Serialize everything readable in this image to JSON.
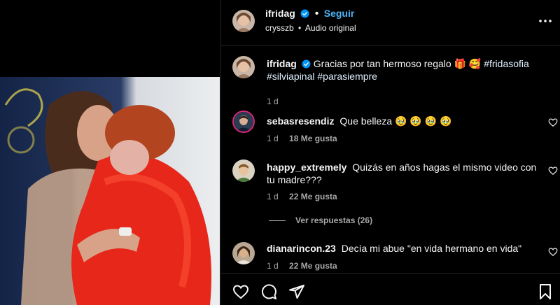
{
  "post": {
    "author": "ifridag",
    "follow_label": "Seguir",
    "audio_user": "crysszb",
    "audio_sep": "•",
    "audio_label": "Audio original"
  },
  "caption": {
    "author": "ifridag",
    "text": "Gracias por tan hermoso regalo 🎁 🥰",
    "hashtags": "#fridasofia #silviapinal #parasiempre",
    "time": "1 d"
  },
  "comments": [
    {
      "user": "sebasresendiz",
      "text": "Que belleza 🥹 🥹 🥹 🥹",
      "time": "1 d",
      "likes": "18 Me gusta"
    },
    {
      "user": "happy_extremely",
      "text": "Quizás en años hagas el mismo video con tu madre???",
      "time": "1 d",
      "likes": "22 Me gusta",
      "replies": "Ver respuestas (26)"
    },
    {
      "user": "dianarincon.23",
      "text": "Decía mi abue \"en vida hermano en vida\"",
      "time": "1 d",
      "likes": "22 Me gusta"
    }
  ],
  "icons": {
    "verified": "verified-badge-icon",
    "more": "more-options-icon",
    "like": "heart-icon",
    "comment": "comment-bubble-icon",
    "share": "paper-plane-icon",
    "save": "bookmark-icon"
  },
  "colors": {
    "accent": "#4cb5f9",
    "background": "#000000",
    "muted": "#a8a8a8",
    "verified": "#0095f6"
  }
}
